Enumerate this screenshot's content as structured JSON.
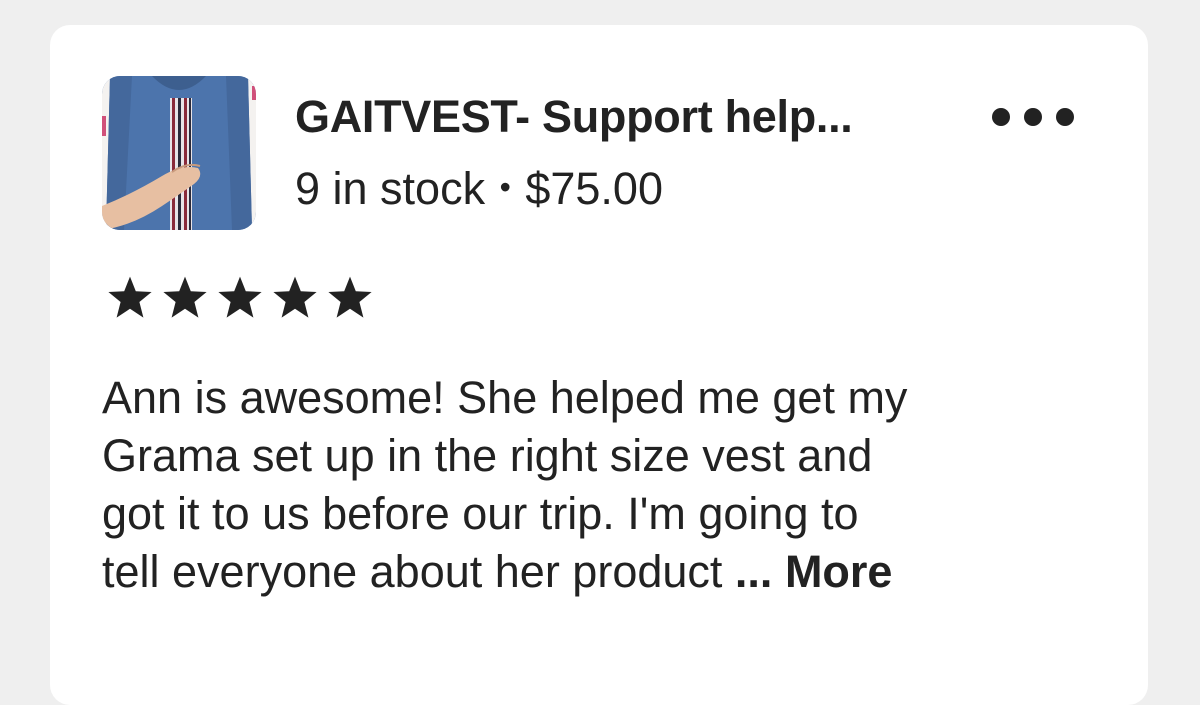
{
  "listing": {
    "title": "GAITVEST- Support help...",
    "stock": "9 in stock",
    "separator": "•",
    "price": "$75.00",
    "thumbnail": "product-photo-blue-vest"
  },
  "review": {
    "rating": 5,
    "rating_max": 5,
    "text_line1": "Ann is awesome! She helped me get my",
    "text_line2": "Grama set up in the right size vest and",
    "text_line3": "got it to us before our trip. I'm going to",
    "text_line4": "tell everyone about her product ",
    "ellipsis": "...",
    "more_label": "More"
  },
  "icons": {
    "options": "more-options-icon",
    "star": "star-icon"
  },
  "colors": {
    "background": "#efefef",
    "card": "#ffffff",
    "text": "#222222"
  }
}
